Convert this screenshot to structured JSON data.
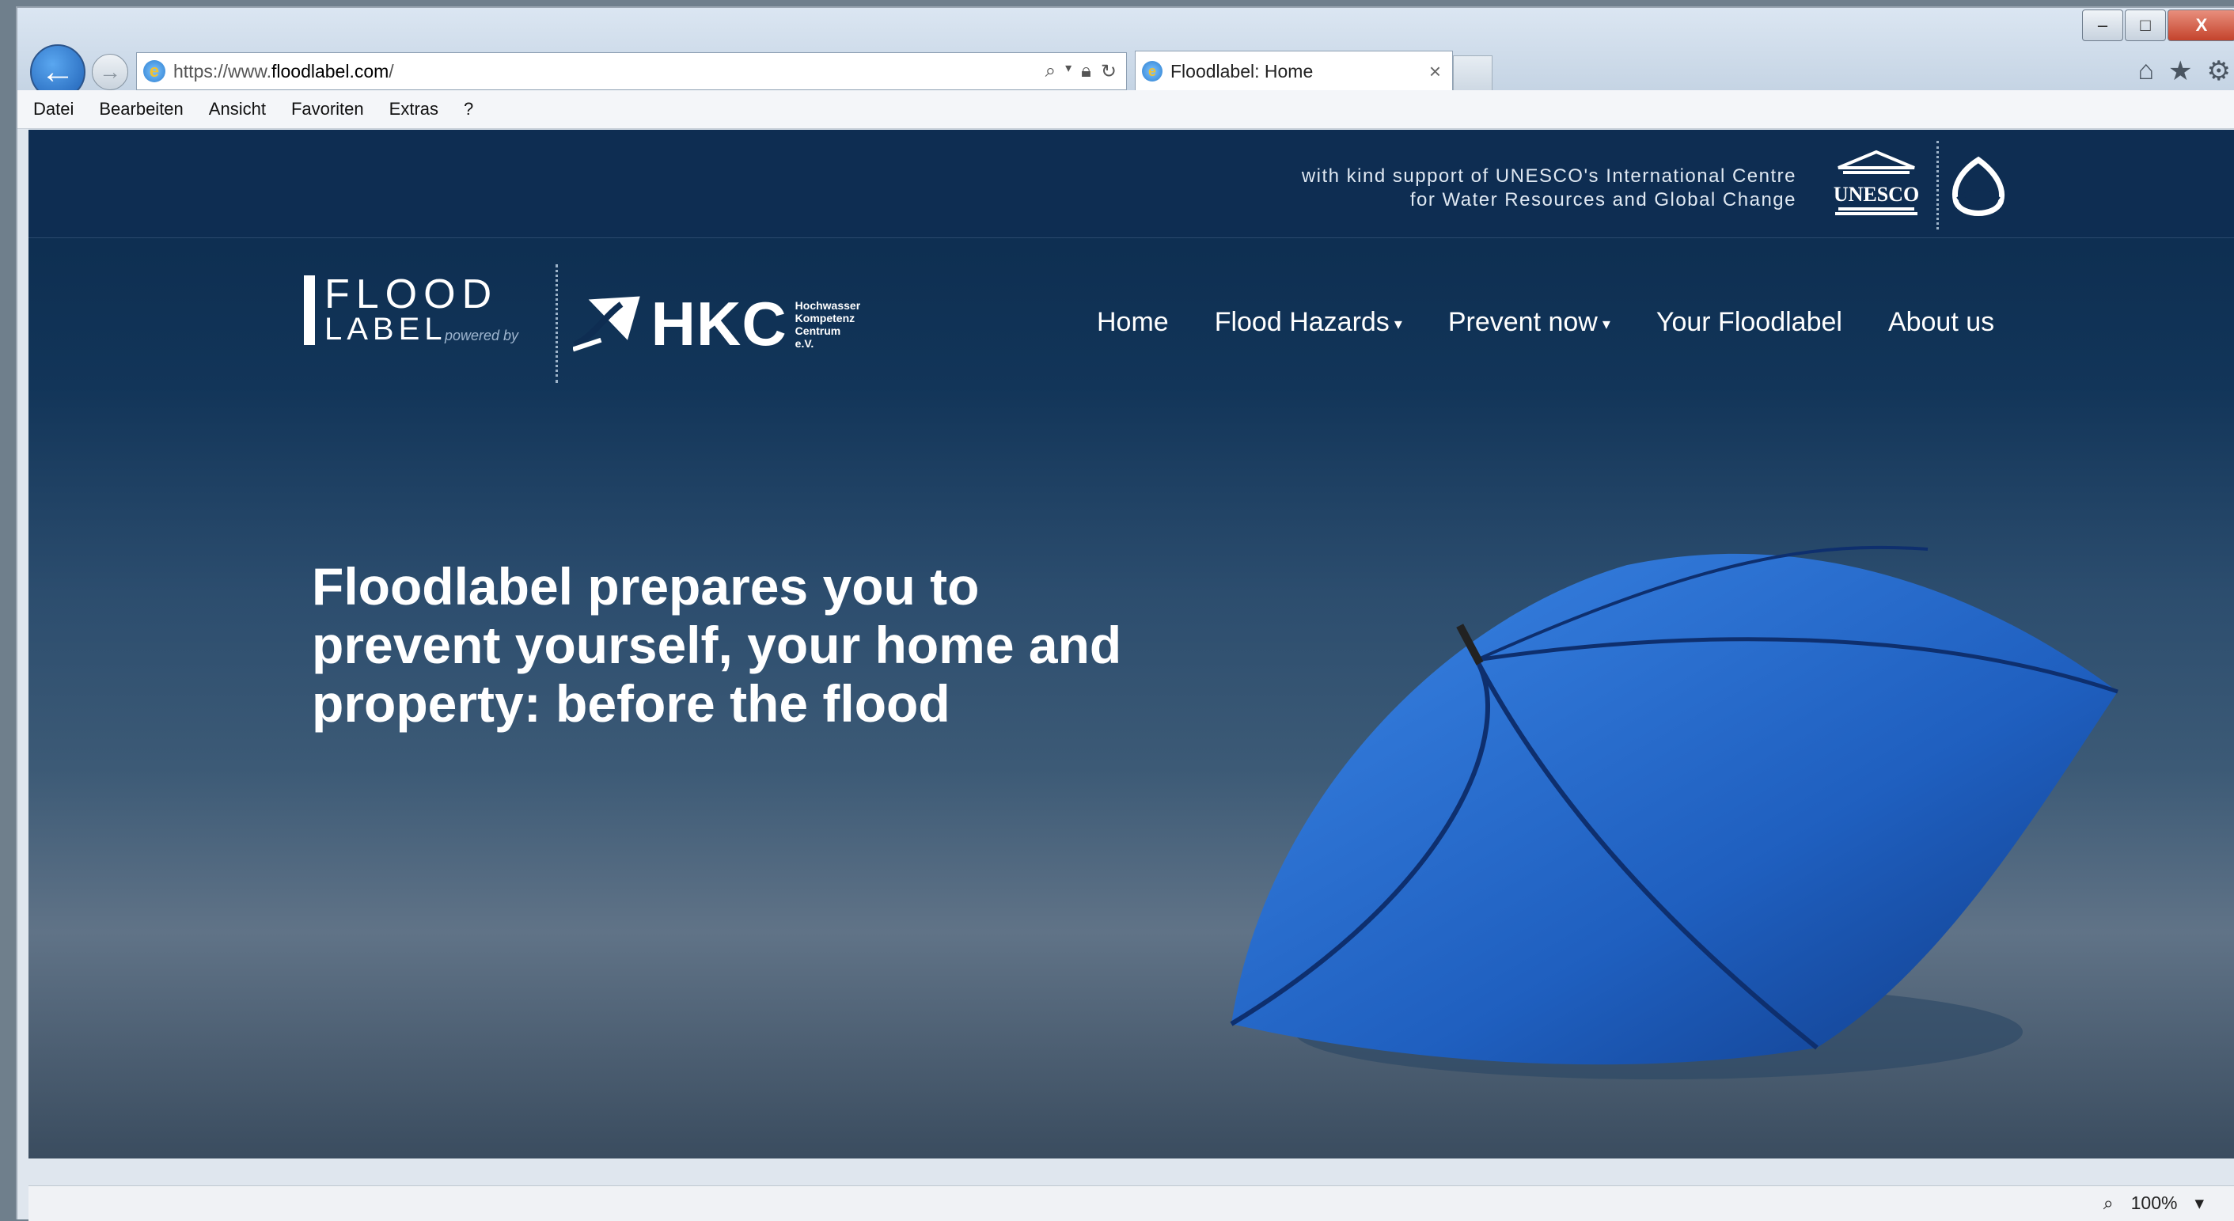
{
  "browser": {
    "url_prefix": "https://www.",
    "url_domain": "floodlabel.com",
    "url_suffix": "/",
    "tab_title": "Floodlabel: Home",
    "tab_close": "×",
    "menu": [
      "Datei",
      "Bearbeiten",
      "Ansicht",
      "Favoriten",
      "Extras",
      "?"
    ],
    "window_controls": {
      "minimize": "–",
      "maximize": "□",
      "close": "X"
    },
    "zoom": "100%"
  },
  "site": {
    "support_line1": "with kind support of UNESCO's International Centre",
    "support_line2": "for Water Resources and Global Change",
    "unesco_text": "UNESCO",
    "flood_word": "FLOOD",
    "label_word": "LABEL",
    "powered_by": "powered by",
    "hkc": "HKC",
    "hkc_line1": "Hochwasser",
    "hkc_line2": "Kompetenz",
    "hkc_line3": "Centrum e.V.",
    "nav": [
      {
        "label": "Home",
        "has_dropdown": false
      },
      {
        "label": "Flood Hazards",
        "has_dropdown": true
      },
      {
        "label": "Prevent now",
        "has_dropdown": true
      },
      {
        "label": "Your Floodlabel",
        "has_dropdown": false
      },
      {
        "label": "About us",
        "has_dropdown": false
      }
    ],
    "headline_line1": "Floodlabel prepares you to",
    "headline_line2": "prevent yourself, your home and",
    "headline_line3": "property: before the flood"
  },
  "colors": {
    "header_bg": "#0e2d52",
    "accent_blue": "#1f63c6"
  }
}
